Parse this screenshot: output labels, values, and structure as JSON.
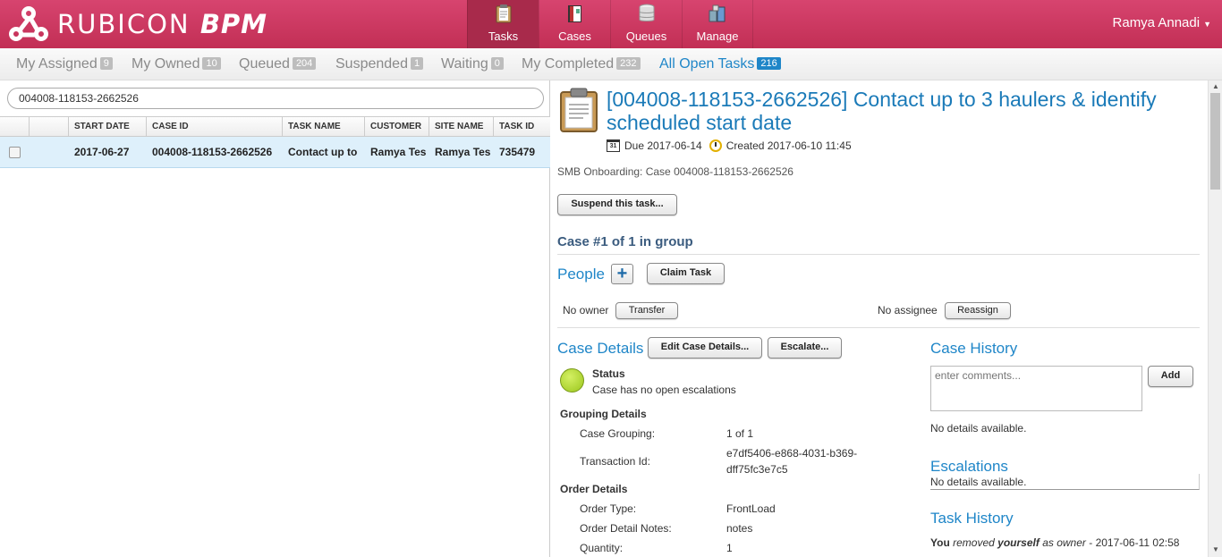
{
  "app": {
    "logo_text": "RUBICON",
    "logo_suffix": "BPM",
    "user_name": "Ramya Annadi",
    "user_caret": "▼"
  },
  "nav": [
    {
      "label": "Tasks",
      "icon": "clipboard-icon",
      "active": true
    },
    {
      "label": "Cases",
      "icon": "binder-icon",
      "active": false
    },
    {
      "label": "Queues",
      "icon": "database-icon",
      "active": false
    },
    {
      "label": "Manage",
      "icon": "manage-icon",
      "active": false
    }
  ],
  "filters": [
    {
      "label": "My Assigned",
      "count": "9"
    },
    {
      "label": "My Owned",
      "count": "10"
    },
    {
      "label": "Queued",
      "count": "204"
    },
    {
      "label": "Suspended",
      "count": "1"
    },
    {
      "label": "Waiting",
      "count": "0"
    },
    {
      "label": "My Completed",
      "count": "232"
    },
    {
      "label": "All Open Tasks",
      "count": "216",
      "active": true
    }
  ],
  "search": {
    "value": "004008-118153-2662526"
  },
  "grid": {
    "columns": [
      "START DATE",
      "CASE ID",
      "TASK NAME",
      "CUSTOMER",
      "SITE NAME",
      "TASK ID"
    ],
    "rows": [
      {
        "start_date": "2017-06-27",
        "case_id": "004008-118153-2662526",
        "task_name": "Contact up to",
        "customer": "Ramya Tes",
        "site_name": "Ramya Tes",
        "task_id": "735479"
      }
    ]
  },
  "task": {
    "title": "[004008-118153-2662526] Contact up to 3 haulers & identify scheduled start date",
    "due": "Due 2017-06-14",
    "calendar_day": "31",
    "created": "Created 2017-06-10 11:45",
    "onboarding": "SMB Onboarding: Case 004008-118153-2662526",
    "suspend_label": "Suspend this task...",
    "case_group": "Case #1 of 1 in group",
    "people_heading": "People",
    "plus_label": "+",
    "claim_label": "Claim Task",
    "no_owner": "No owner",
    "transfer_label": "Transfer",
    "no_assignee": "No assignee",
    "reassign_label": "Reassign"
  },
  "case_details": {
    "heading": "Case Details",
    "edit_label": "Edit Case Details...",
    "escalate_label": "Escalate...",
    "status_label": "Status",
    "status_text": "Case has no open escalations",
    "status_color": "#a9d22a",
    "grouping_heading": "Grouping Details",
    "case_grouping_label": "Case Grouping:",
    "case_grouping_value": "1 of 1",
    "transaction_label": "Transaction Id:",
    "transaction_value_1": "e7df5406-e868-4031-b369-",
    "transaction_value_2": "dff75fc3e7c5",
    "order_heading": "Order Details",
    "order_type_label": "Order Type:",
    "order_type_value": "FrontLoad",
    "order_notes_label": "Order Detail Notes:",
    "order_notes_value": "notes",
    "quantity_label": "Quantity:",
    "quantity_value": "1"
  },
  "case_history": {
    "heading": "Case History",
    "placeholder": "enter comments...",
    "add_label": "Add",
    "no_details": "No details available."
  },
  "escalations": {
    "heading": "Escalations",
    "no_details": "No details available."
  },
  "task_history": {
    "heading": "Task History",
    "entry_you": "You",
    "entry_removed": "removed",
    "entry_yourself": "yourself",
    "entry_as_owner": "as owner",
    "entry_time": "- 2017-06-11 02:58"
  },
  "colors": {
    "brand": "#c8325a",
    "accent": "#1f86c8",
    "row_highlight": "#def0fb"
  }
}
